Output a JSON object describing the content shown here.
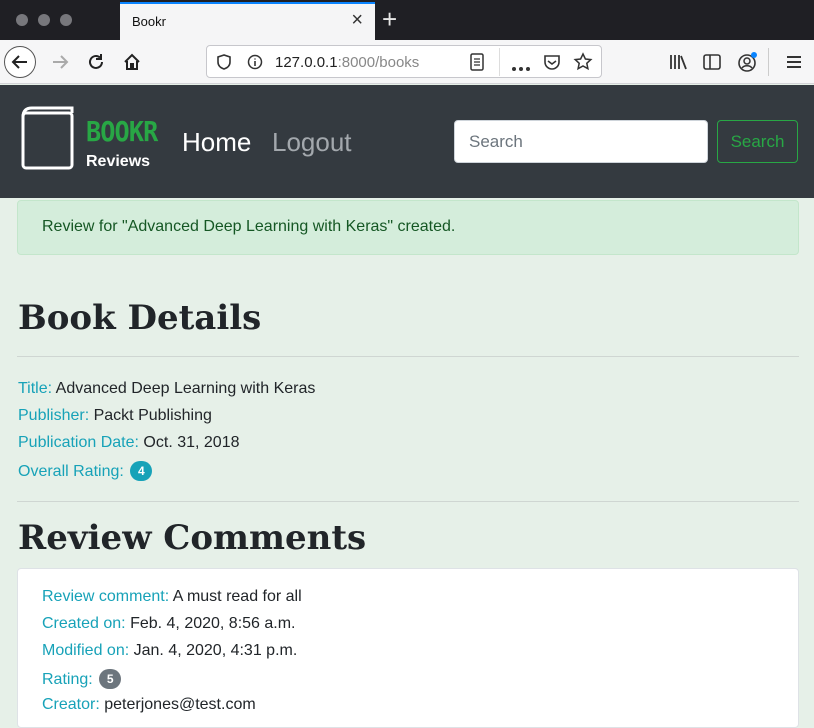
{
  "browser": {
    "tab_title": "Bookr",
    "url_host": "127.0.0.1",
    "url_rest": ":8000/books"
  },
  "header": {
    "brand": "BOOKR",
    "brand_sub": "Reviews",
    "nav_home": "Home",
    "nav_logout": "Logout",
    "search_placeholder": "Search",
    "search_button": "Search"
  },
  "alert": {
    "message": "Review for \"Advanced Deep Learning with Keras\" created."
  },
  "book": {
    "heading": "Book Details",
    "title_label": "Title:",
    "title": "Advanced Deep Learning with Keras",
    "publisher_label": "Publisher:",
    "publisher": "Packt Publishing",
    "pubdate_label": "Publication Date:",
    "pubdate": "Oct. 31, 2018",
    "rating_label": "Overall Rating:",
    "rating": "4"
  },
  "reviews": {
    "heading": "Review Comments",
    "items": [
      {
        "comment_label": "Review comment:",
        "comment": "A must read for all",
        "created_label": "Created on:",
        "created": "Feb. 4, 2020, 8:56 a.m.",
        "modified_label": "Modified on:",
        "modified": "Jan. 4, 2020, 4:31 p.m.",
        "rating_label": "Rating:",
        "rating": "5",
        "creator_label": "Creator:",
        "creator": "peterjones@test.com"
      }
    ]
  },
  "colors": {
    "brand_green": "#28a745",
    "label_teal": "#17a2b8",
    "header_bg": "#343a40",
    "alert_bg": "#d4eddb"
  }
}
